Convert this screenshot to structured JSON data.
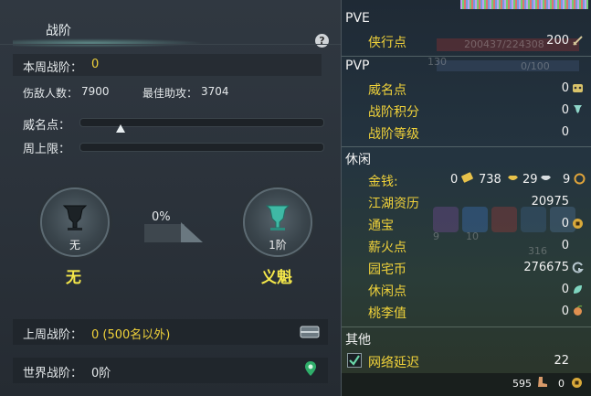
{
  "left": {
    "title": "战阶",
    "help_symbol": "?",
    "week_rank_label": "本周战阶：",
    "week_rank_value": "0",
    "kills_label": "伤敌人数：",
    "kills_value": "7900",
    "assist_label": "最佳助攻：",
    "assist_value": "3704",
    "fame_label": "威名点：",
    "cap_label": "周上限：",
    "progress_percent": "0%",
    "current_badge": {
      "level": "无",
      "name": "无"
    },
    "next_badge": {
      "level": "1阶",
      "name": "义魁"
    },
    "last_week_label": "上周战阶：",
    "last_week_value": "0 (500名以外)",
    "world_label": "世界战阶：",
    "world_value": "0阶"
  },
  "right": {
    "pve": {
      "title": "PVE",
      "items": [
        {
          "label": "侠行点",
          "value": "200"
        }
      ],
      "ghost_bar": "200437/224308"
    },
    "pvp": {
      "title": "PVP",
      "ghost_level": "130",
      "ghost_bar": "0/100",
      "items": [
        {
          "label": "威名点",
          "value": "0"
        },
        {
          "label": "战阶积分",
          "value": "0"
        },
        {
          "label": "战阶等级",
          "value": "0"
        }
      ]
    },
    "leisure": {
      "title": "休闲",
      "money_label": "金钱:",
      "money_a": "0",
      "money_b": "738",
      "money_c": "29",
      "money_d": "9",
      "items": [
        {
          "label": "江湖资历",
          "value": "20975"
        },
        {
          "label": "通宝",
          "value": "0"
        },
        {
          "label": "薪火点",
          "value": "0"
        },
        {
          "label": "园宅币",
          "value": "276675"
        },
        {
          "label": "休闲点",
          "value": "0"
        },
        {
          "label": "桃李值",
          "value": "0"
        }
      ],
      "ghost_nums": [
        "9",
        "10",
        "316"
      ]
    },
    "other": {
      "title": "其他",
      "net_label": "网络延迟",
      "net_value": "22"
    },
    "footer": {
      "a": "595",
      "b": "0"
    }
  }
}
